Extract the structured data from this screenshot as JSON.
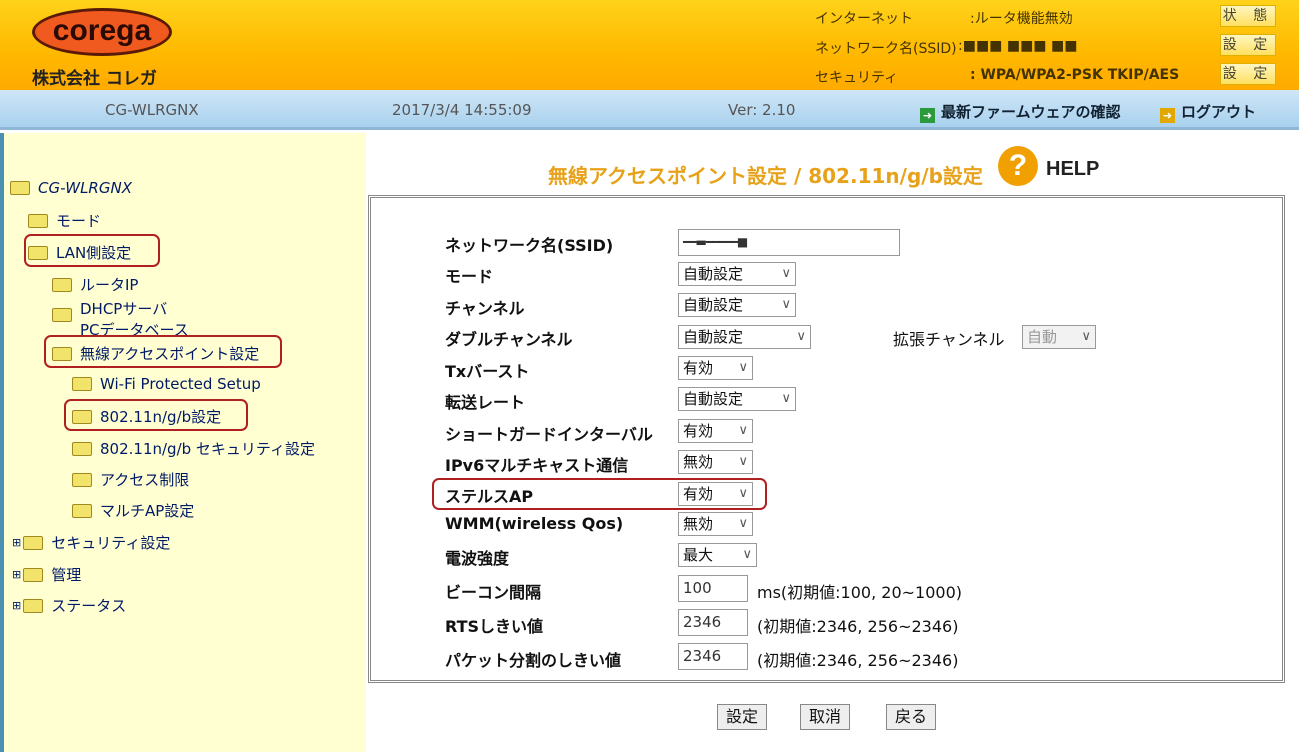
{
  "header": {
    "logo": "corega",
    "company": "株式会社 コレガ",
    "status": [
      {
        "label": "インターネット",
        "value": ":ルータ機能無効",
        "button": "状 態"
      },
      {
        "label": "ネットワーク名(SSID)",
        "value": ":■■■ ■■■ ■■",
        "button": "設 定"
      },
      {
        "label": "セキュリティ",
        "value": ": WPA/WPA2-PSK TKIP/AES",
        "button": "設 定"
      }
    ]
  },
  "bar": {
    "model": "CG-WLRGNX",
    "datetime": "2017/3/4 14:55:09",
    "version": "Ver: 2.10",
    "firmware_link": "最新ファームウェアの確認",
    "logout_link": "ログアウト"
  },
  "tree": {
    "root": "CG-WLRGNX",
    "mode": "モード",
    "lan": "LAN側設定",
    "router_ip": "ルータIP",
    "dhcp1": "DHCPサーバ",
    "dhcp2": "PCデータベース",
    "wireless": "無線アクセスポイント設定",
    "wps": "Wi-Fi Protected Setup",
    "basic": "802.11n/g/b設定",
    "security80211": "802.11n/g/b セキュリティ設定",
    "access": "アクセス制限",
    "multiap": "マルチAP設定",
    "security": "セキュリティ設定",
    "admin": "管理",
    "status": "ステータス"
  },
  "main": {
    "title": "無線アクセスポイント設定 / 802.11n/g/b設定",
    "help": "HELP",
    "ssid_label": "ネットワーク名(SSID)",
    "ssid_value": "━━▬━━━━━■",
    "rows": [
      {
        "label": "モード",
        "value": "自動設定"
      },
      {
        "label": "チャンネル",
        "value": "自動設定"
      },
      {
        "label": "ダブルチャンネル",
        "value": "自動設定"
      },
      {
        "label": "Txバースト",
        "value": "有効"
      },
      {
        "label": "転送レート",
        "value": "自動設定"
      },
      {
        "label": "ショートガードインターバル",
        "value": "有効"
      },
      {
        "label": "IPv6マルチキャスト通信",
        "value": "無効"
      },
      {
        "label": "ステルスAP",
        "value": "有効"
      },
      {
        "label": "WMM(wireless  Qos)",
        "value": "無効"
      },
      {
        "label": "電波強度",
        "value": "最大"
      }
    ],
    "ext_channel_label": "拡張チャンネル",
    "ext_channel_value": "自動",
    "beacon_label": "ビーコン間隔",
    "beacon_value": "100",
    "beacon_note": "ms(初期値:100, 20~1000)",
    "rts_label": "RTSしきい値",
    "rts_value": "2346",
    "rts_note": "(初期値:2346, 256~2346)",
    "frag_label": "パケット分割のしきい値",
    "frag_value": "2346",
    "frag_note": "(初期値:2346, 256~2346)",
    "buttons": {
      "set": "設定",
      "cancel": "取消",
      "back": "戻る"
    }
  }
}
